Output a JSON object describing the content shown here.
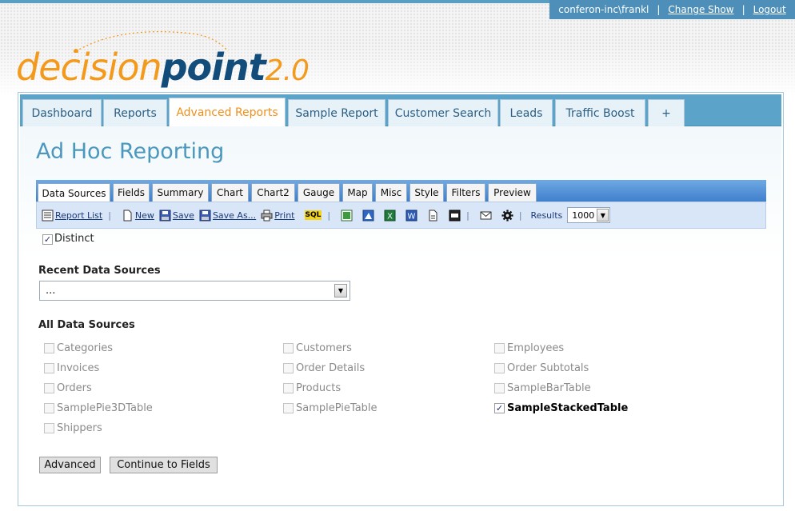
{
  "user_bar": {
    "user": "conferon-inc\\frankl",
    "separator": "|",
    "change_show": "Change Show",
    "logout": "Logout"
  },
  "logo": {
    "part1": "decision",
    "part2": "point",
    "part3": "2.0"
  },
  "nav": {
    "tabs": [
      {
        "label": "Dashboard"
      },
      {
        "label": "Reports"
      },
      {
        "label": "Advanced Reports",
        "active": true
      },
      {
        "label": "Sample Report"
      },
      {
        "label": "Customer Search"
      },
      {
        "label": "Leads"
      },
      {
        "label": "Traffic Boost"
      },
      {
        "label": "+"
      }
    ]
  },
  "page_title": "Ad Hoc Reporting",
  "subtabs": [
    {
      "label": "Data Sources",
      "active": true
    },
    {
      "label": "Fields"
    },
    {
      "label": "Summary"
    },
    {
      "label": "Chart"
    },
    {
      "label": "Chart2"
    },
    {
      "label": "Gauge"
    },
    {
      "label": "Map"
    },
    {
      "label": "Misc"
    },
    {
      "label": "Style"
    },
    {
      "label": "Filters"
    },
    {
      "label": "Preview"
    }
  ],
  "toolbar": {
    "report_list": "Report List",
    "new": "New",
    "save": "Save",
    "save_as": "Save As...",
    "print": "Print",
    "sql": "SQL",
    "results_label": "Results",
    "results_value": "1000",
    "separator": "|"
  },
  "distinct": {
    "label": "Distinct",
    "checked": true,
    "mark": "✓"
  },
  "recent": {
    "label": "Recent Data Sources",
    "value": "..."
  },
  "all_sources": {
    "label": "All Data Sources",
    "mark": "✓",
    "items": [
      {
        "label": "Categories"
      },
      {
        "label": "Customers"
      },
      {
        "label": "Employees"
      },
      {
        "label": "Invoices"
      },
      {
        "label": "Order Details"
      },
      {
        "label": "Order Subtotals"
      },
      {
        "label": "Orders"
      },
      {
        "label": "Products"
      },
      {
        "label": "SampleBarTable"
      },
      {
        "label": "SamplePie3DTable"
      },
      {
        "label": "SamplePieTable"
      },
      {
        "label": "SampleStackedTable",
        "checked": true
      },
      {
        "label": "Shippers"
      }
    ]
  },
  "buttons": {
    "advanced": "Advanced",
    "continue": "Continue to Fields"
  },
  "colors": {
    "accent": "#f0901a",
    "nav_blue": "#5ba3c8",
    "title_blue": "#4b97be"
  },
  "icons": {
    "report_list": "report-list-icon",
    "new": "new-doc-icon",
    "save": "save-disk-icon",
    "save_as": "save-as-disk-icon",
    "print": "printer-icon",
    "sql": "sql-icon",
    "email": "envelope-icon",
    "settings": "gear-icon"
  }
}
